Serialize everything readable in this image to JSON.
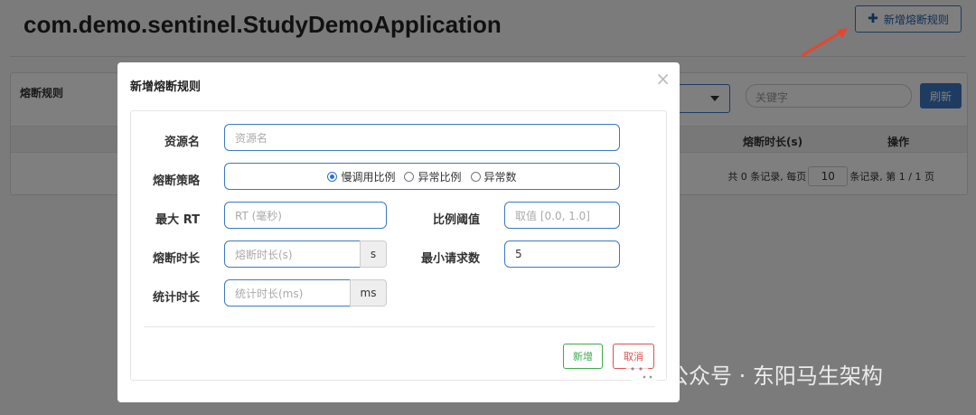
{
  "page": {
    "title": "com.demo.sentinel.StudyDemoApplication",
    "add_rule_button": "新增熔断规则",
    "add_rule_icon": "plus-icon"
  },
  "panel": {
    "title": "熔断规则",
    "keyword_placeholder": "关键字",
    "refresh_button": "刷新",
    "columns": [
      "熔断时长(s)",
      "操作"
    ],
    "pagination": {
      "prefix": "共 0 条记录, 每页",
      "page_size": "10",
      "suffix": "条记录, 第 1 / 1 页"
    }
  },
  "modal": {
    "title": "新增熔断规则",
    "close": "×",
    "fields": {
      "resource_label": "资源名",
      "resource_placeholder": "资源名",
      "strategy_label": "熔断策略",
      "strategy_options": [
        "慢调用比例",
        "异常比例",
        "异常数"
      ],
      "strategy_selected": "慢调用比例",
      "max_rt_label": "最大 RT",
      "max_rt_placeholder": "RT (毫秒)",
      "ratio_label": "比例阈值",
      "ratio_placeholder": "取值 [0.0, 1.0]",
      "duration_label": "熔断时长",
      "duration_placeholder": "熔断时长(s)",
      "duration_unit": "s",
      "min_request_label": "最小请求数",
      "min_request_value": "5",
      "stat_label": "统计时长",
      "stat_placeholder": "统计时长(ms)",
      "stat_unit": "ms"
    },
    "buttons": {
      "add": "新增",
      "cancel": "取消"
    }
  },
  "watermark": {
    "text": "公众号 · 东阳马生架构"
  },
  "colors": {
    "accent": "#3c79c2",
    "annotation_arrow": "#e8452c",
    "success": "#3bab4a",
    "danger": "#d9534f"
  }
}
